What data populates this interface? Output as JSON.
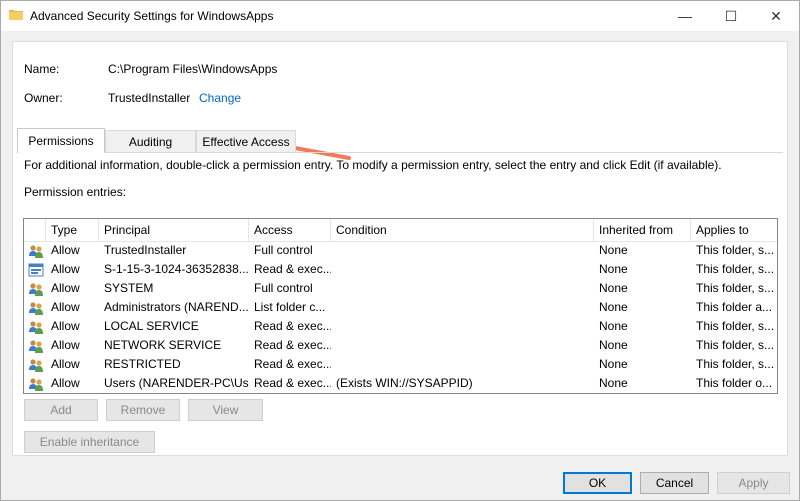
{
  "window": {
    "title": "Advanced Security Settings for WindowsApps",
    "minimize_symbol": "—",
    "maximize_symbol": "☐",
    "close_symbol": "✕"
  },
  "info": {
    "name_label": "Name:",
    "name_value": "C:\\Program Files\\WindowsApps",
    "owner_label": "Owner:",
    "owner_value": "TrustedInstaller",
    "change_link": "Change"
  },
  "tabs": [
    {
      "label": "Permissions",
      "active": true
    },
    {
      "label": "Auditing",
      "active": false
    },
    {
      "label": "Effective Access",
      "active": false
    }
  ],
  "permissions": {
    "info_text": "For additional information, double-click a permission entry. To modify a permission entry, select the entry and click Edit (if available).",
    "entries_label": "Permission entries:",
    "columns": [
      "Type",
      "Principal",
      "Access",
      "Condition",
      "Inherited from",
      "Applies to"
    ],
    "rows": [
      {
        "icon": "users-icon",
        "type": "Allow",
        "principal": "TrustedInstaller",
        "access": "Full control",
        "condition": "",
        "inherited": "None",
        "applies": "This folder, s..."
      },
      {
        "icon": "app-package-icon",
        "type": "Allow",
        "principal": "S-1-15-3-1024-36352838...",
        "access": "Read & exec...",
        "condition": "",
        "inherited": "None",
        "applies": "This folder, s..."
      },
      {
        "icon": "users-icon",
        "type": "Allow",
        "principal": "SYSTEM",
        "access": "Full control",
        "condition": "",
        "inherited": "None",
        "applies": "This folder, s..."
      },
      {
        "icon": "users-icon",
        "type": "Allow",
        "principal": "Administrators (NAREND...",
        "access": "List folder c...",
        "condition": "",
        "inherited": "None",
        "applies": "This folder a..."
      },
      {
        "icon": "users-icon",
        "type": "Allow",
        "principal": "LOCAL SERVICE",
        "access": "Read & exec...",
        "condition": "",
        "inherited": "None",
        "applies": "This folder, s..."
      },
      {
        "icon": "users-icon",
        "type": "Allow",
        "principal": "NETWORK SERVICE",
        "access": "Read & exec...",
        "condition": "",
        "inherited": "None",
        "applies": "This folder, s..."
      },
      {
        "icon": "users-icon",
        "type": "Allow",
        "principal": "RESTRICTED",
        "access": "Read & exec...",
        "condition": "",
        "inherited": "None",
        "applies": "This folder, s..."
      },
      {
        "icon": "users-icon",
        "type": "Allow",
        "principal": "Users (NARENDER-PC\\Us...",
        "access": "Read & exec...",
        "condition": "(Exists WIN://SYSAPPID)",
        "inherited": "None",
        "applies": "This folder o..."
      }
    ],
    "add_button": "Add",
    "remove_button": "Remove",
    "view_button": "View",
    "enable_inheritance_button": "Enable inheritance"
  },
  "footer": {
    "ok_button": "OK",
    "cancel_button": "Cancel",
    "apply_button": "Apply"
  },
  "colors": {
    "link": "#0066cc",
    "annotation_arrow": "#f07a5a"
  }
}
